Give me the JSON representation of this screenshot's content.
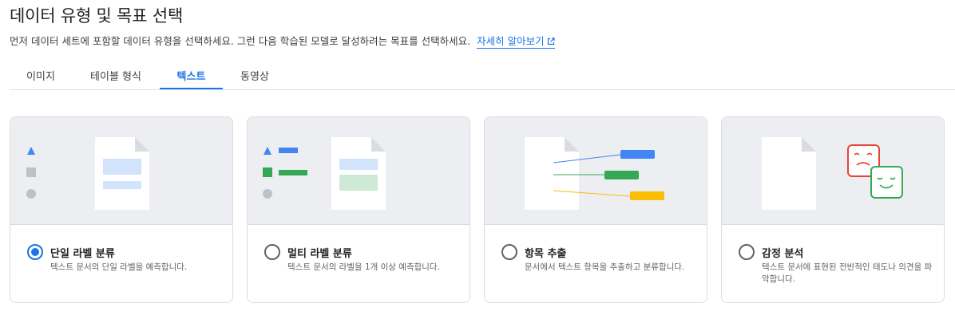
{
  "header": {
    "title": "데이터 유형 및 목표 선택",
    "subtitle": "먼저 데이터 세트에 포함할 데이터 유형을 선택하세요. 그런 다음 학습된 모델로 달성하려는 목표를 선택하세요.",
    "learn_more": "자세히 알아보기",
    "learn_more_icon": "open-in-new-icon"
  },
  "tabs": [
    {
      "label": "이미지",
      "active": false
    },
    {
      "label": "테이블 형식",
      "active": false
    },
    {
      "label": "텍스트",
      "active": true
    },
    {
      "label": "동영상",
      "active": false
    }
  ],
  "cards": [
    {
      "title": "단일 라벨 분류",
      "description": "텍스트 문서의 단일 라벨을 예측합니다.",
      "selected": true
    },
    {
      "title": "멀티 라벨 분류",
      "description": "텍스트 문서의 라벨을 1개 이상 예측합니다.",
      "selected": false
    },
    {
      "title": "항목 추출",
      "description": "문서에서 텍스트 항목을 추출하고 분류합니다.",
      "selected": false
    },
    {
      "title": "감정 분석",
      "description": "텍스트 문서에 표현된 전반적인 태도나 의견을 파악합니다.",
      "selected": false
    }
  ],
  "colors": {
    "accent": "#1a73e8",
    "blue": "#4285f4",
    "green": "#34a853",
    "yellow": "#fbbc04",
    "red": "#ea4335",
    "grey_shape": "#bdc1c6",
    "illustration_bg": "#eceef1"
  }
}
